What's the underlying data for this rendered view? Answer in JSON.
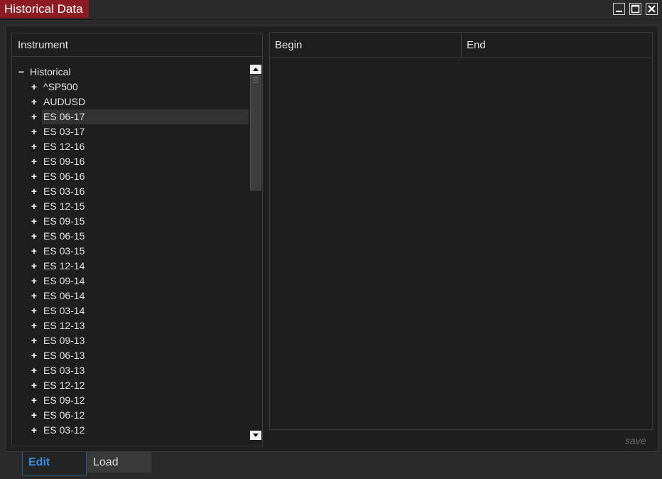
{
  "window": {
    "title": "Historical Data"
  },
  "left_panel": {
    "header": "Instrument",
    "tree": {
      "root": {
        "toggle": "−",
        "label": "Historical"
      },
      "children": [
        {
          "toggle": "+",
          "label": "^SP500"
        },
        {
          "toggle": "+",
          "label": "AUDUSD"
        },
        {
          "toggle": "+",
          "label": "ES 06-17"
        },
        {
          "toggle": "+",
          "label": "ES 03-17"
        },
        {
          "toggle": "+",
          "label": "ES 12-16"
        },
        {
          "toggle": "+",
          "label": "ES 09-16"
        },
        {
          "toggle": "+",
          "label": "ES 06-16"
        },
        {
          "toggle": "+",
          "label": "ES 03-16"
        },
        {
          "toggle": "+",
          "label": "ES 12-15"
        },
        {
          "toggle": "+",
          "label": "ES 09-15"
        },
        {
          "toggle": "+",
          "label": "ES 06-15"
        },
        {
          "toggle": "+",
          "label": "ES 03-15"
        },
        {
          "toggle": "+",
          "label": "ES 12-14"
        },
        {
          "toggle": "+",
          "label": "ES 09-14"
        },
        {
          "toggle": "+",
          "label": "ES 06-14"
        },
        {
          "toggle": "+",
          "label": "ES 03-14"
        },
        {
          "toggle": "+",
          "label": "ES 12-13"
        },
        {
          "toggle": "+",
          "label": "ES 09-13"
        },
        {
          "toggle": "+",
          "label": "ES 06-13"
        },
        {
          "toggle": "+",
          "label": "ES 03-13"
        },
        {
          "toggle": "+",
          "label": "ES 12-12"
        },
        {
          "toggle": "+",
          "label": "ES 09-12"
        },
        {
          "toggle": "+",
          "label": "ES 06-12"
        },
        {
          "toggle": "+",
          "label": "ES 03-12"
        }
      ],
      "selected": "ES 06-17"
    }
  },
  "right_panel": {
    "columns": {
      "begin": "Begin",
      "end": "End"
    },
    "save_label": "save"
  },
  "tabs": {
    "edit": "Edit",
    "load": "Load",
    "active": "Edit"
  },
  "colors": {
    "title_accent": "#8d1b24",
    "active_tab": "#3a8ee6"
  }
}
